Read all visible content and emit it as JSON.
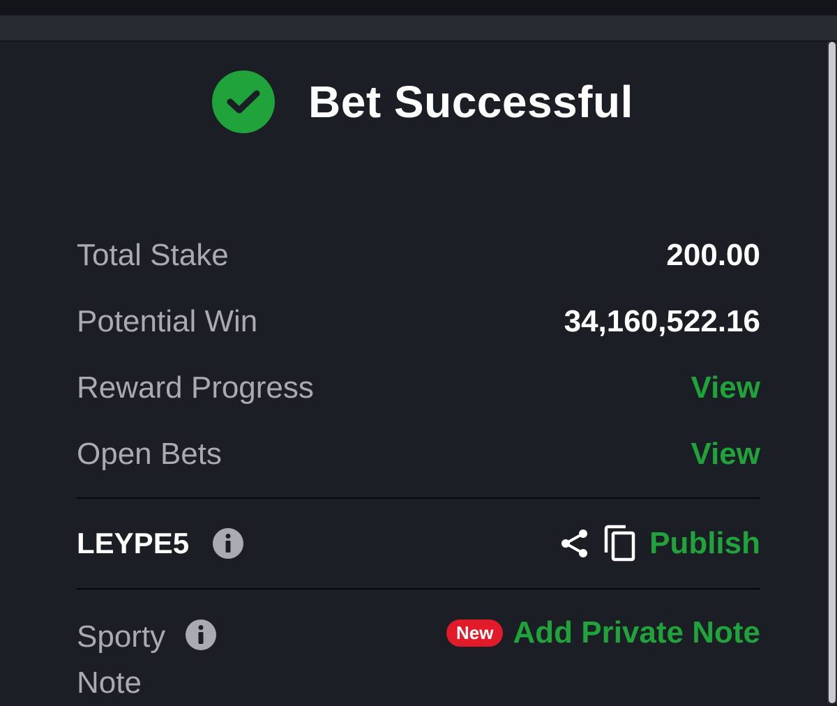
{
  "header": {
    "title": "Bet Successful",
    "success_icon": "check-circle-icon",
    "accent_color": "#1fa33a"
  },
  "summary": [
    {
      "label": "Total Stake",
      "value": "200.00",
      "kind": "value"
    },
    {
      "label": "Potential Win",
      "value": "34,160,522.16",
      "kind": "value"
    },
    {
      "label": "Reward Progress",
      "value": "View",
      "kind": "link"
    },
    {
      "label": "Open Bets",
      "value": "View",
      "kind": "link"
    }
  ],
  "booking": {
    "code": "LEYPE5",
    "info_icon": "info-icon",
    "share_icon": "share-icon",
    "copy_icon": "copy-icon",
    "publish_label": "Publish"
  },
  "note": {
    "label": "Sporty Note",
    "info_icon": "info-icon",
    "badge": "New",
    "badge_color": "#e21b2a",
    "action_label": "Add Private Note"
  }
}
